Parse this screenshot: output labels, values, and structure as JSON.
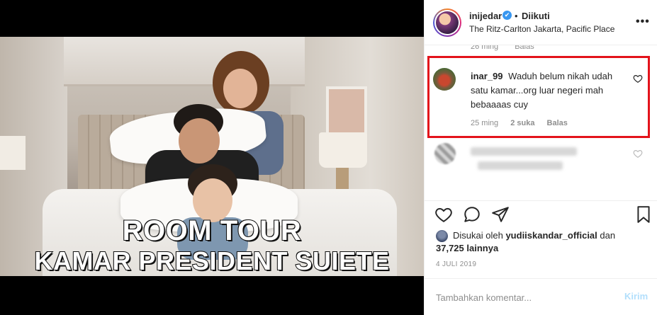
{
  "post": {
    "overlay_line1": "ROOM TOUR",
    "overlay_line2": "KAMAR PRESIDENT SUIETE"
  },
  "header": {
    "username": "inijedar",
    "verified_icon": "✔",
    "separator": "•",
    "follow_label": "Diikuti",
    "location": "The Ritz-Carlton Jakarta, Pacific Place",
    "more_icon": "•••"
  },
  "previous_comment_meta": {
    "time": "26 ming",
    "reply": "Balas"
  },
  "highlighted_comment": {
    "username": "inar_99",
    "text": "Waduh belum nikah udah satu kamar...org luar negeri mah bebaaaas cuy",
    "time": "25 ming",
    "likes": "2 suka",
    "reply": "Balas",
    "highlight_color": "#e3131b"
  },
  "likes": {
    "prefix": "Disukai oleh",
    "user": "yudiiskandar_official",
    "conjunction": "dan",
    "count": "37,725 lainnya"
  },
  "date": "4 JULI 2019",
  "composer": {
    "placeholder": "Tambahkan komentar...",
    "post_label": "Kirim"
  },
  "icons": {
    "like": "heart-icon",
    "comment": "comment-icon",
    "share": "share-icon",
    "save": "bookmark-icon"
  }
}
